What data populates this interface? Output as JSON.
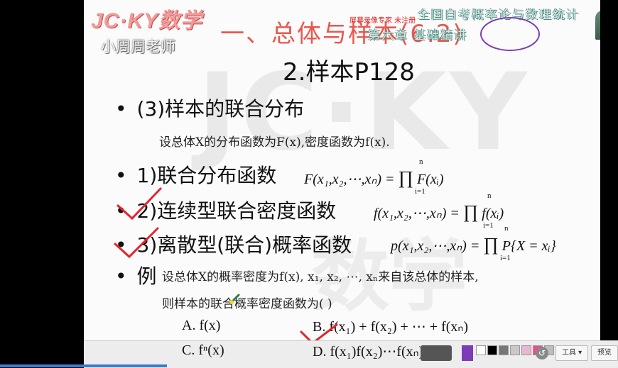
{
  "header": {
    "logo": "JC·KY数学",
    "teacher": "小周周老师",
    "title": "一、总体与样本(6.2)",
    "recorder_badge": "屏幕录像专家 未注册",
    "course": "全国自考概率论与数理统计",
    "chapter": "第六章 基础精讲"
  },
  "slide": {
    "subtitle": "2.样本P128",
    "bullet3": "(3)样本的联合分布",
    "premise": "设总体X的分布函数为F(x),密度函数为f(x).",
    "items": [
      {
        "label": "1)联合分布函数",
        "formula_left": "F(x₁,x₂,⋯,xₙ) = ",
        "formula_right": " F(xᵢ)"
      },
      {
        "label": "2)连续型联合密度函数",
        "formula_left": "f(x₁,x₂,⋯,xₙ) = ",
        "formula_right": " f(xᵢ)"
      },
      {
        "label": "3)离散型(联合)概率函数",
        "formula_left": "p(x₁,x₂,⋯,xₙ) = ",
        "formula_right": " P{X = xᵢ}"
      }
    ],
    "prod_symbol": "∏",
    "prod_upper": "n",
    "prod_lower": "i=1",
    "example_mark": "例",
    "example_line1": "设总体X的概率密度为f(x), x₁, x₂, ⋯, xₙ来自该总体的样本,",
    "example_line2": "则样本的联合概率密度函数为(      )",
    "choices": {
      "a": "A. f(x)",
      "b": "B. f(x₁) + f(x₂) + ⋯ + f(xₙ)",
      "c": "C. fⁿ(x)",
      "d": "D. f(x₁)f(x₂)⋯f(xₙ)"
    }
  },
  "toolbar": {
    "tools_label": "工具",
    "preview_label": "预览",
    "colors": [
      "#ffffff",
      "#000000",
      "#777777",
      "#c9c9c9",
      "#e8b7d1",
      "#f04c8a",
      "#bdbdbd"
    ]
  }
}
